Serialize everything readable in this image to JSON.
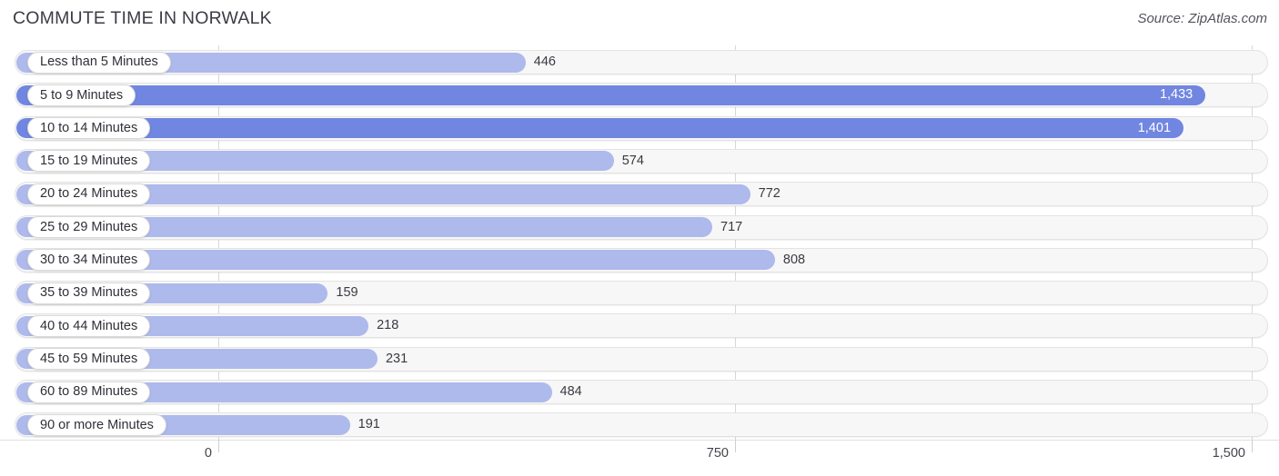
{
  "header": {
    "title": "COMMUTE TIME IN NORWALK",
    "source": "Source: ZipAtlas.com"
  },
  "chart_data": {
    "type": "bar",
    "orientation": "horizontal",
    "title": "COMMUTE TIME IN NORWALK",
    "xlabel": "",
    "ylabel": "",
    "xlim": [
      0,
      1500
    ],
    "grid": true,
    "legend": null,
    "xticks": [
      0,
      750,
      1500
    ],
    "xtick_labels": [
      "0",
      "750",
      "1,500"
    ],
    "categories": [
      "Less than 5 Minutes",
      "5 to 9 Minutes",
      "10 to 14 Minutes",
      "15 to 19 Minutes",
      "20 to 24 Minutes",
      "25 to 29 Minutes",
      "30 to 34 Minutes",
      "35 to 39 Minutes",
      "40 to 44 Minutes",
      "45 to 59 Minutes",
      "60 to 89 Minutes",
      "90 or more Minutes"
    ],
    "values": [
      446,
      1433,
      1401,
      574,
      772,
      717,
      808,
      159,
      218,
      231,
      484,
      191
    ],
    "value_labels": [
      "446",
      "1,433",
      "1,401",
      "574",
      "772",
      "717",
      "808",
      "159",
      "218",
      "231",
      "484",
      "191"
    ],
    "bars": [
      {
        "label": "Less than 5 Minutes",
        "value": 446,
        "value_label": "446",
        "color": "#aeb9ec",
        "label_inside": false
      },
      {
        "label": "5 to 9 Minutes",
        "value": 1433,
        "value_label": "1,433",
        "color": "#7086e0",
        "label_inside": true
      },
      {
        "label": "10 to 14 Minutes",
        "value": 1401,
        "value_label": "1,401",
        "color": "#7086e0",
        "label_inside": true
      },
      {
        "label": "15 to 19 Minutes",
        "value": 574,
        "value_label": "574",
        "color": "#aeb9ec",
        "label_inside": false
      },
      {
        "label": "20 to 24 Minutes",
        "value": 772,
        "value_label": "772",
        "color": "#aeb9ec",
        "label_inside": false
      },
      {
        "label": "25 to 29 Minutes",
        "value": 717,
        "value_label": "717",
        "color": "#aeb9ec",
        "label_inside": false
      },
      {
        "label": "30 to 34 Minutes",
        "value": 808,
        "value_label": "808",
        "color": "#aeb9ec",
        "label_inside": false
      },
      {
        "label": "35 to 39 Minutes",
        "value": 159,
        "value_label": "159",
        "color": "#aeb9ec",
        "label_inside": false
      },
      {
        "label": "40 to 44 Minutes",
        "value": 218,
        "value_label": "218",
        "color": "#aeb9ec",
        "label_inside": false
      },
      {
        "label": "45 to 59 Minutes",
        "value": 231,
        "value_label": "231",
        "color": "#aeb9ec",
        "label_inside": false
      },
      {
        "label": "60 to 89 Minutes",
        "value": 484,
        "value_label": "484",
        "color": "#aeb9ec",
        "label_inside": false
      },
      {
        "label": "90 or more Minutes",
        "value": 191,
        "value_label": "191",
        "color": "#aeb9ec",
        "label_inside": false
      }
    ],
    "colors": {
      "bar_light": "#aeb9ec",
      "bar_dark": "#7086e0",
      "track": "#f7f7f7",
      "gridline": "#d8d8d8",
      "text": "#3a3a42"
    }
  }
}
